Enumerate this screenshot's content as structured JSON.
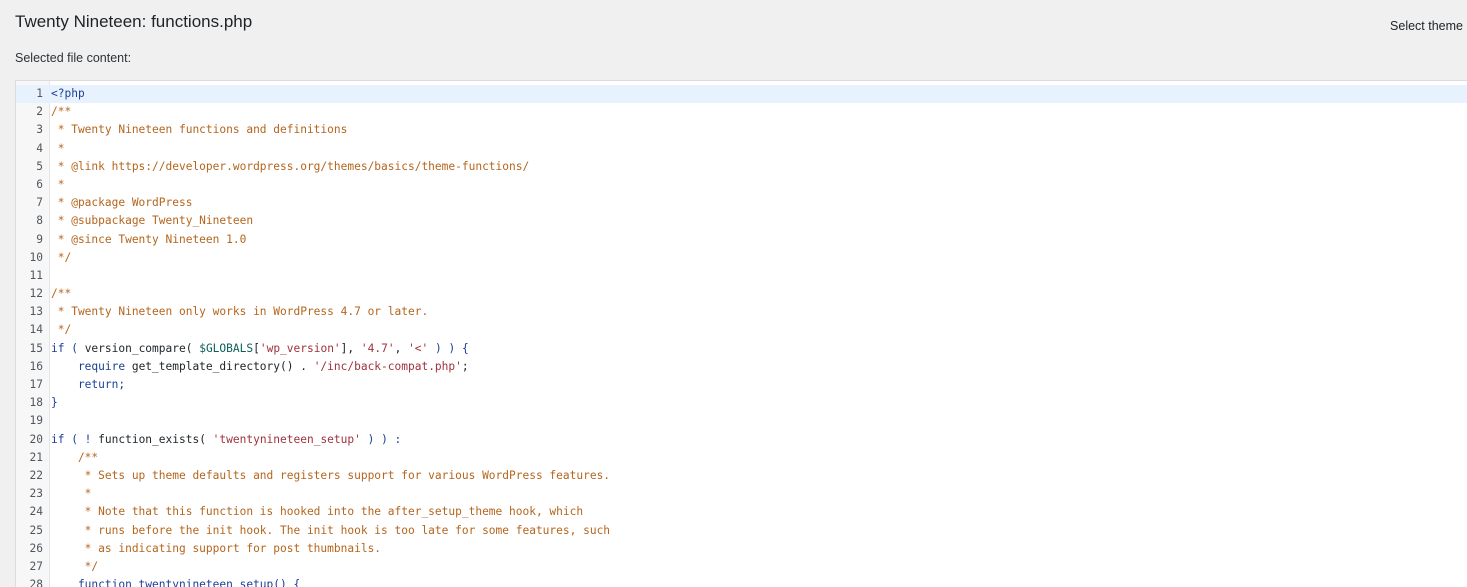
{
  "header": {
    "title": "Twenty Nineteen: functions.php",
    "select_theme_label": "Select theme"
  },
  "editor": {
    "selected_label": "Selected file content:",
    "lines": [
      {
        "n": "1",
        "text": "<?php",
        "kind": "kw"
      },
      {
        "n": "2",
        "text": "/**",
        "kind": "c"
      },
      {
        "n": "3",
        "text": " * Twenty Nineteen functions and definitions",
        "kind": "c"
      },
      {
        "n": "4",
        "text": " *",
        "kind": "c"
      },
      {
        "n": "5",
        "text": " * @link https://developer.wordpress.org/themes/basics/theme-functions/",
        "kind": "c"
      },
      {
        "n": "6",
        "text": " *",
        "kind": "c"
      },
      {
        "n": "7",
        "text": " * @package WordPress",
        "kind": "c"
      },
      {
        "n": "8",
        "text": " * @subpackage Twenty_Nineteen",
        "kind": "c"
      },
      {
        "n": "9",
        "text": " * @since Twenty Nineteen 1.0",
        "kind": "c"
      },
      {
        "n": "10",
        "text": " */",
        "kind": "c"
      },
      {
        "n": "11",
        "text": "",
        "kind": "k"
      },
      {
        "n": "12",
        "text": "/**",
        "kind": "c"
      },
      {
        "n": "13",
        "text": " * Twenty Nineteen only works in WordPress 4.7 or later.",
        "kind": "c"
      },
      {
        "n": "14",
        "text": " */",
        "kind": "c"
      },
      {
        "n": "15",
        "text": "if ( version_compare( $GLOBALS['wp_version'], '4.7', '<' ) ) {",
        "kind": "mix15"
      },
      {
        "n": "16",
        "text": "    require get_template_directory() . '/inc/back-compat.php';",
        "kind": "mix16"
      },
      {
        "n": "17",
        "text": "    return;",
        "kind": "kw"
      },
      {
        "n": "18",
        "text": "}",
        "kind": "kw"
      },
      {
        "n": "19",
        "text": "",
        "kind": "k"
      },
      {
        "n": "20",
        "text": "if ( ! function_exists( 'twentynineteen_setup' ) ) :",
        "kind": "mix20"
      },
      {
        "n": "21",
        "text": "    /**",
        "kind": "c"
      },
      {
        "n": "22",
        "text": "     * Sets up theme defaults and registers support for various WordPress features.",
        "kind": "c"
      },
      {
        "n": "23",
        "text": "     *",
        "kind": "c"
      },
      {
        "n": "24",
        "text": "     * Note that this function is hooked into the after_setup_theme hook, which",
        "kind": "c"
      },
      {
        "n": "25",
        "text": "     * runs before the init hook. The init hook is too late for some features, such",
        "kind": "c"
      },
      {
        "n": "26",
        "text": "     * as indicating support for post thumbnails.",
        "kind": "c"
      },
      {
        "n": "27",
        "text": "     */",
        "kind": "c"
      },
      {
        "n": "28",
        "text": "    function twentynineteen_setup() {",
        "kind": "kw"
      }
    ]
  }
}
